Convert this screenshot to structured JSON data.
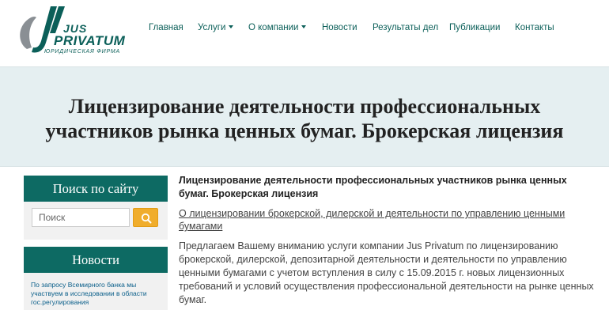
{
  "logo": {
    "line1": "JUS",
    "line2": "PRIVATUM",
    "tagline": "ЮРИДИЧЕСКАЯ ФИРМА"
  },
  "nav": {
    "items": [
      {
        "label": "Главная"
      },
      {
        "label": "Услуги"
      },
      {
        "label": "О компании"
      },
      {
        "label": "Новости"
      },
      {
        "label": "Результаты дел"
      },
      {
        "label": "Публикации"
      },
      {
        "label": "Контакты"
      }
    ]
  },
  "banner": {
    "title": "Лицензирование деятельности профессиональных участников рынка ценных бумаг. Брокерская лицензия"
  },
  "sidebar": {
    "search_heading": "Поиск по сайту",
    "search_placeholder": "Поиск",
    "news_heading": "Новости",
    "news_item": "По запросу Всемирного банка мы участвуем в исследовании в области гос.регулирования"
  },
  "main": {
    "title": "Лицензирование деятельности профессиональных участников рынка ценных бумаг. Брокерская лицензия",
    "link": "О лицензировании брокерской, дилерской и деятельности по управлению ценными бумагами",
    "paragraph": "Предлагаем Вашему вниманию услуги компании Jus Privatum по лицензированию брокерской, дилерской, депозитарной деятельности и деятельности по управлению ценными бумагами с учетом вступления в силу с 15.09.2015 г. новых лицензионных требований и условий осуществления  профессиональной деятельности на рынке ценных бумаг."
  },
  "colors": {
    "brand": "#0d6a63",
    "banner_bg": "#e5eff1",
    "search_button": "#f0ad2c",
    "news_link": "#0b5f8a"
  },
  "icons": [
    "logo-swoosh-icon",
    "search-icon",
    "caret-down-icon"
  ]
}
